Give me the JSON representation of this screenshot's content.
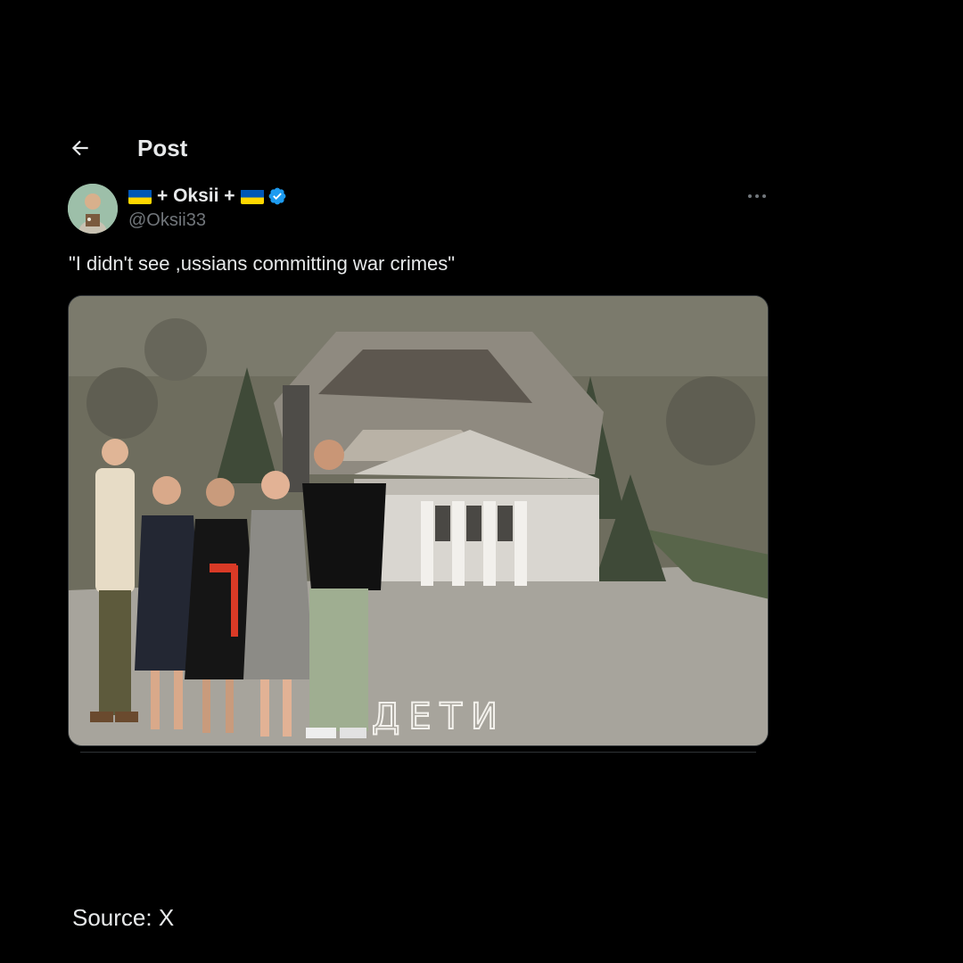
{
  "header": {
    "title": "Post"
  },
  "post": {
    "author": {
      "display_name": "+ Oksii +",
      "handle": "@Oksii33",
      "verified": true
    },
    "text": "\"I didn't see ,ussians committing war crimes\"",
    "media": {
      "image_text": "ДЕТИ"
    }
  },
  "footer": {
    "source": "Source: X"
  },
  "icons": {
    "back": "arrow-left-icon",
    "more": "more-horizontal-icon",
    "verified": "verified-badge-icon",
    "flag": "ukraine-flag-icon"
  },
  "colors": {
    "background": "#000000",
    "text": "#e7e9ea",
    "secondary_text": "#71767b",
    "verified_blue": "#1d9bf0",
    "flag_blue": "#0057b7",
    "flag_yellow": "#ffd700"
  }
}
